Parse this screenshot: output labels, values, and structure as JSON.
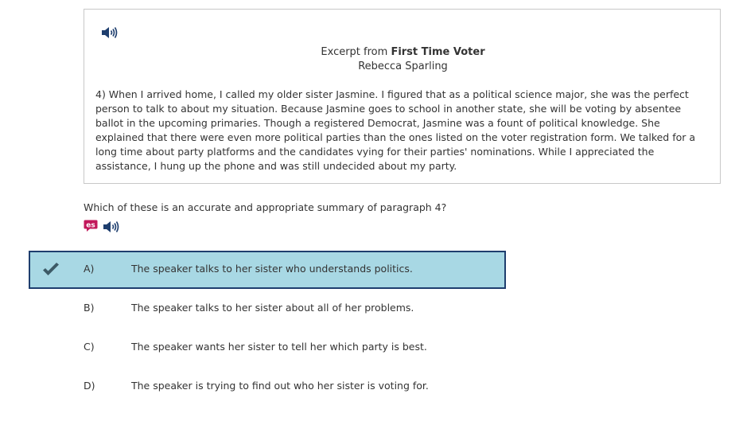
{
  "passage": {
    "audio_icon": "speaker-icon",
    "title_prefix": "Excerpt from",
    "title": "First Time Voter",
    "author": "Rebecca Sparling",
    "text": "4) When I arrived home, I called my older sister Jasmine. I figured that as a political science major, she was the perfect person to talk to about my situation. Because Jasmine goes to school in another state, she will be voting by absentee ballot in the upcoming primaries. Though a registered Democrat, Jasmine was a fount of political knowledge. She explained that there were even more political parties than the ones listed on the voter registration form. We talked for a long time about party platforms and the candidates vying for their parties' nominations. While I appreciated the assistance, I hung up the phone and was still undecided about my party."
  },
  "question": {
    "text": "Which of these is an accurate and appropriate summary of paragraph 4?",
    "translate_icon": "es-translate-icon",
    "audio_icon": "speaker-icon"
  },
  "choices": [
    {
      "letter": "A)",
      "text": "The speaker talks to her sister who understands politics.",
      "selected": true
    },
    {
      "letter": "B)",
      "text": "The speaker talks to her sister about all of her problems.",
      "selected": false
    },
    {
      "letter": "C)",
      "text": "The speaker wants her sister to tell her which party is best.",
      "selected": false
    },
    {
      "letter": "D)",
      "text": "The speaker is trying to find out who her sister is voting for.",
      "selected": false
    }
  ],
  "colors": {
    "selected_bg": "#a8d8e4",
    "selected_border": "#1e3e6e",
    "check": "#3d5a66",
    "translate_badge": "#c2185b",
    "speaker": "#1e3e6e"
  }
}
